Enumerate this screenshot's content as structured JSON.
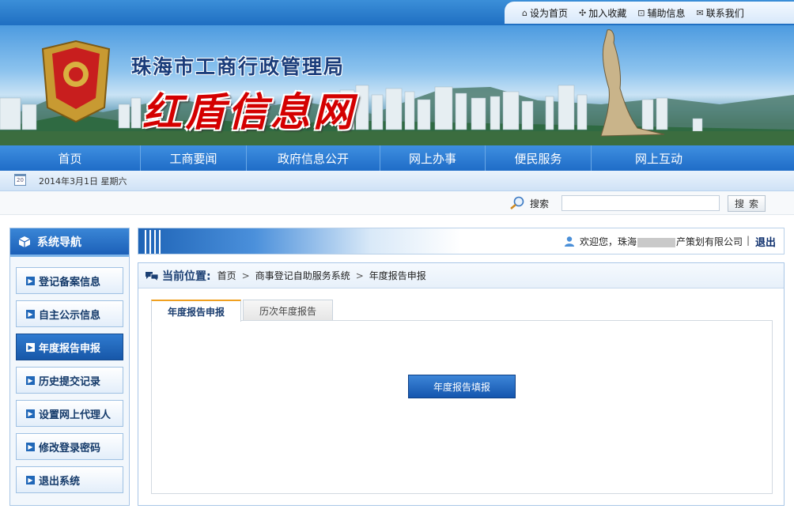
{
  "toplinks": [
    {
      "icon": "home-icon",
      "glyph": "⌂",
      "label": "设为首页"
    },
    {
      "icon": "star-icon",
      "glyph": "✣",
      "label": "加入收藏"
    },
    {
      "icon": "help-icon",
      "glyph": "⊡",
      "label": "辅助信息"
    },
    {
      "icon": "mail-icon",
      "glyph": "✉",
      "label": "联系我们"
    }
  ],
  "banner": {
    "subtitle": "珠海市工商行政管理局",
    "title": "红盾信息网"
  },
  "nav": [
    "首页",
    "工商要闻",
    "政府信息公开",
    "网上办事",
    "便民服务",
    "网上互动"
  ],
  "date": {
    "icon_text": "20",
    "text": "2014年3月1日  星期六"
  },
  "search": {
    "label": "搜索",
    "value": "",
    "button": "搜索"
  },
  "sidebar": {
    "title": "系统导航",
    "items": [
      {
        "label": "登记备案信息",
        "active": false
      },
      {
        "label": "自主公示信息",
        "active": false
      },
      {
        "label": "年度报告申报",
        "active": true
      },
      {
        "label": "历史提交记录",
        "active": false
      },
      {
        "label": "设置网上代理人",
        "active": false
      },
      {
        "label": "修改登录密码",
        "active": false
      },
      {
        "label": "退出系统",
        "active": false
      }
    ]
  },
  "welcome": {
    "prefix": "欢迎您，珠海",
    "suffix": "产策划有限公司",
    "separator": "|",
    "logout": "退出"
  },
  "breadcrumb": {
    "label": "当前位置:",
    "items": [
      "首页",
      "商事登记自助服务系统",
      "年度报告申报"
    ]
  },
  "tabs": [
    {
      "label": "年度报告申报",
      "active": true
    },
    {
      "label": "历次年度报告",
      "active": false
    }
  ],
  "primary_button": "年度报告填报",
  "colors": {
    "brand_blue": "#1f6cc7",
    "title_red": "#d40000",
    "tab_accent": "#f0a020"
  }
}
